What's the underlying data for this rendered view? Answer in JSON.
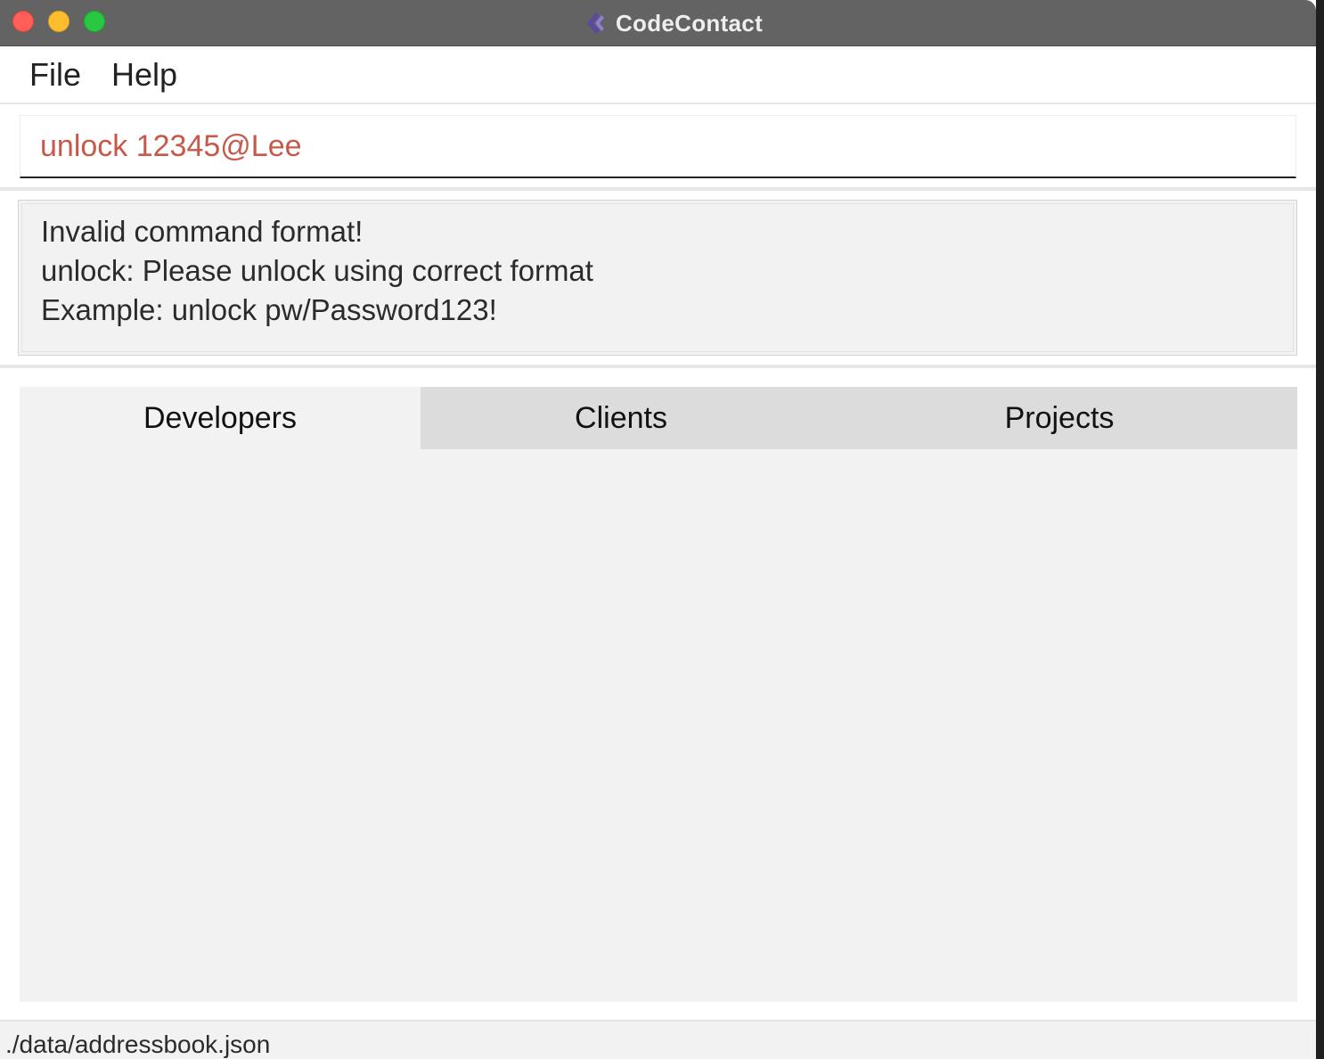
{
  "window": {
    "title": "CodeContact"
  },
  "menu": {
    "items": [
      "File",
      "Help"
    ]
  },
  "command_box": {
    "value": "unlock 12345@Lee",
    "text_color": "#c7594a"
  },
  "result_display": {
    "lines": [
      "Invalid command format!",
      "unlock: Please unlock using correct format",
      "Example: unlock pw/Password123!"
    ]
  },
  "tabs": {
    "items": [
      "Developers",
      "Clients",
      "Projects"
    ],
    "selected": "Developers"
  },
  "status_bar": {
    "file_path": "./data/addressbook.json"
  },
  "icons": {
    "app": "codecontact-logo-icon",
    "close": "close-window-icon",
    "minimize": "minimize-window-icon",
    "zoom": "zoom-window-icon"
  },
  "colors": {
    "titlebar": "#636363",
    "close": "#ff5f57",
    "minimize": "#febc2e",
    "zoom": "#28c840",
    "panel_background": "#f2f2f2",
    "tab_inactive": "#dcdcdc"
  }
}
